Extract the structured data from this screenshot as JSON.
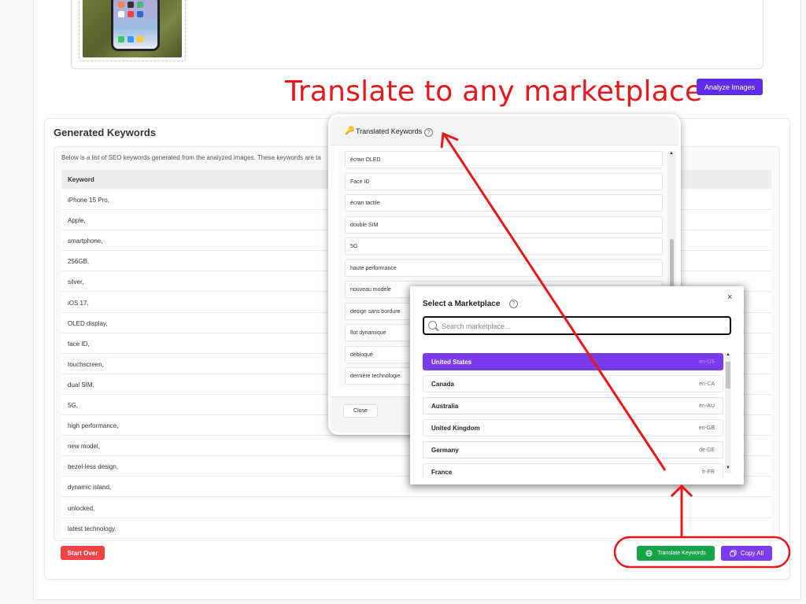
{
  "promo_text": "Translate to any marketplace",
  "analyze_button": "Analyze Images",
  "keywords_section": {
    "title": "Generated Keywords",
    "description": "Below is a list of SEO keywords generated from the analyzed images. These keywords are ta",
    "column_header": "Keyword",
    "rows": [
      "iPhone 15 Pro,",
      "Apple,",
      "smartphone,",
      "256GB,",
      "silver,",
      "iOS 17,",
      "OLED display,",
      "face ID,",
      "touchscreen,",
      "dual SIM,",
      "5G,",
      "high performance,",
      "new model,",
      "bezel-less design,",
      "dynamic island,",
      "unlocked,",
      "latest technology."
    ]
  },
  "buttons": {
    "start_over": "Start Over",
    "translate": "Translate Keywords",
    "copy_all": "Copy All"
  },
  "translated_modal": {
    "title": "Translated Keywords",
    "close": "Close",
    "items": [
      "écran OLED",
      "Face ID",
      "écran tactile",
      "double SIM",
      "5G",
      "haute performance",
      "nouveau modèle",
      "design sans bordure",
      "îlot dynamique",
      "débloqué",
      "dernière technologie."
    ]
  },
  "marketplace_modal": {
    "title": "Select a Marketplace",
    "search_placeholder": "Search marketplace...",
    "close_symbol": "×",
    "items": [
      {
        "name": "United States",
        "code": "en-US",
        "selected": true
      },
      {
        "name": "Canada",
        "code": "en-CA",
        "selected": false
      },
      {
        "name": "Australia",
        "code": "en-AU",
        "selected": false
      },
      {
        "name": "United Kingdom",
        "code": "en-GB",
        "selected": false
      },
      {
        "name": "Germany",
        "code": "de-DE",
        "selected": false
      },
      {
        "name": "France",
        "code": "fr-FR",
        "selected": false
      }
    ]
  },
  "colors": {
    "annotation_red": "#e8171b",
    "primary_purple": "#7c3aed",
    "analyze_blue": "#5b2ee6",
    "translate_green": "#16a34a",
    "start_red": "#ef4444"
  },
  "icons": {
    "key": "key-icon",
    "help": "question-circle-icon",
    "globe": "globe-icon",
    "copy": "copy-icon",
    "search": "search-icon",
    "close": "close-icon"
  }
}
